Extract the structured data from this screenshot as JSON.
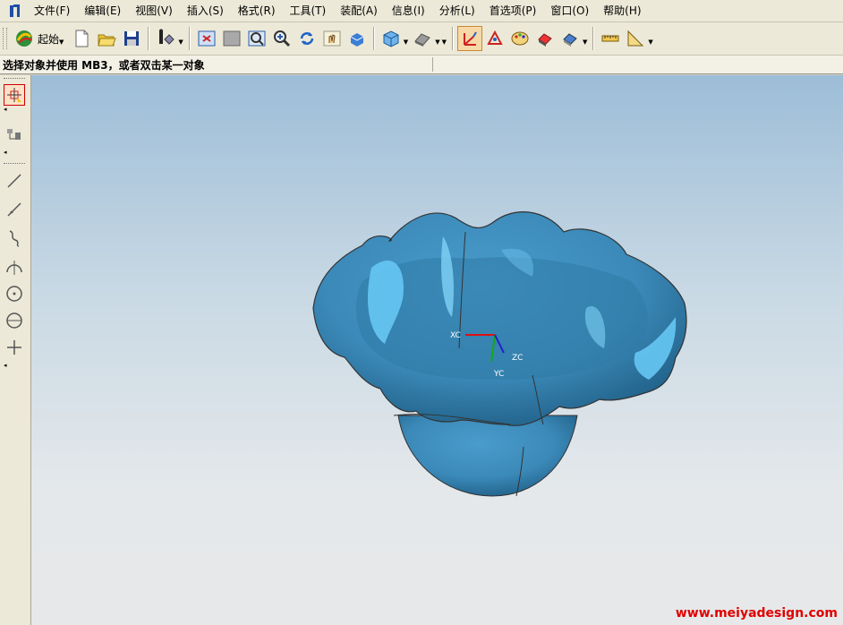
{
  "menubar": {
    "items": [
      {
        "label": "文件(F)"
      },
      {
        "label": "编辑(E)"
      },
      {
        "label": "视图(V)"
      },
      {
        "label": "插入(S)"
      },
      {
        "label": "格式(R)"
      },
      {
        "label": "工具(T)"
      },
      {
        "label": "装配(A)"
      },
      {
        "label": "信息(I)"
      },
      {
        "label": "分析(L)"
      },
      {
        "label": "首选项(P)"
      },
      {
        "label": "窗口(O)"
      },
      {
        "label": "帮助(H)"
      }
    ]
  },
  "toolbar": {
    "start_label": "起始"
  },
  "cue_line": {
    "text": "选择对象并使用 MB3，或者双击某一对象"
  },
  "viewport": {
    "triad": {
      "x_label": "XC",
      "y_label": "YC",
      "z_label": "ZC"
    },
    "watermark": "www.meiyadesign.com"
  },
  "colors": {
    "model_fill": "#3b89b8",
    "model_highlight": "#66c7f3",
    "watermark": "#e00000"
  }
}
